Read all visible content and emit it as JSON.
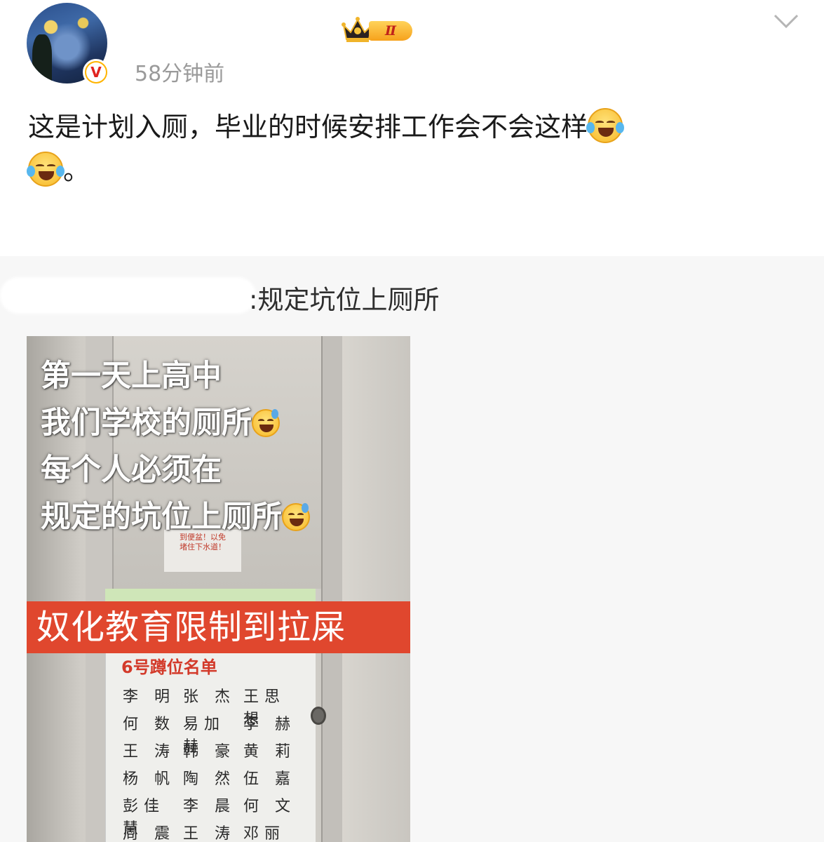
{
  "post": {
    "timestamp": "58分钟前",
    "vip_level": "Ⅱ",
    "text_line1": "这是计划入厕，毕业的时候安排工作会不会这样",
    "text_line2_tail": "。",
    "emoji_name": "laughing-crying-emoji"
  },
  "repost": {
    "text": ":规定坑位上厕所"
  },
  "image": {
    "overlay_line1": "第一天上高中",
    "overlay_line2": "我们学校的厕所",
    "overlay_line3": "每个人必须在",
    "overlay_line4": "规定的坑位上厕所",
    "banner": "奴化教育限制到拉屎",
    "small_sign_line1": "到便盆！以免",
    "small_sign_line2": "堵住下水道！",
    "list_title": "6号蹲位名单",
    "names": [
      [
        "李 明",
        "张 杰",
        "王思想"
      ],
      [
        "何 数",
        "易加赫",
        "李 赫"
      ],
      [
        "王 涛",
        "韩 豪",
        "黄 莉"
      ],
      [
        "杨 帆",
        "陶 然",
        "伍 嘉"
      ],
      [
        "彭佳慧",
        "李 晨",
        "何 文"
      ],
      [
        "周 震",
        "王 涛",
        "邓丽欣"
      ]
    ]
  },
  "icons": {
    "verified": "verified-badge-icon",
    "crown": "crown-icon",
    "more": "chevron-down-icon"
  },
  "colors": {
    "accent_orange": "#f6a21c",
    "banner_red": "#e0472e",
    "timestamp_gray": "#9a9a9a"
  }
}
